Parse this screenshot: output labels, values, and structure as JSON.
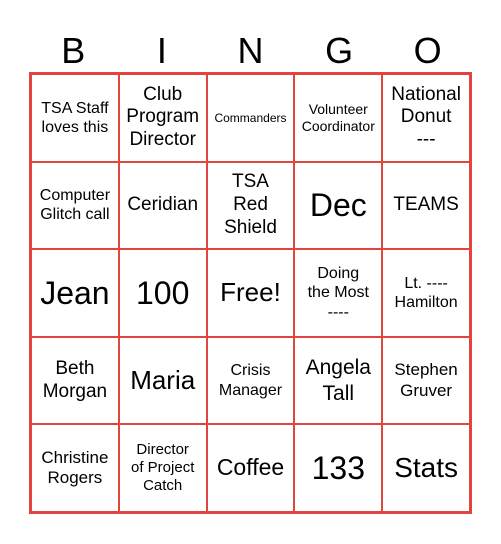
{
  "title_letters": [
    "B",
    "I",
    "N",
    "G",
    "O"
  ],
  "border_color": "#e0463e",
  "cells": [
    [
      "TSA Staff\nloves this",
      "Club\nProgram\nDirector",
      "Commanders",
      "Volunteer\nCoordinator",
      "National\nDonut\n---"
    ],
    [
      "Computer\nGlitch call",
      "Ceridian",
      "TSA\nRed\nShield",
      "Dec",
      "TEAMS"
    ],
    [
      "Jean",
      "100",
      "Free!",
      "Doing\nthe Most\n----",
      "Lt. ----\nHamilton"
    ],
    [
      "Beth\nMorgan",
      "Maria",
      "Crisis\nManager",
      "Angela\nTall",
      "Stephen\nGruver"
    ],
    [
      "Christine\nRogers",
      "Director\nof Project\nCatch",
      "Coffee",
      "133",
      "Stats"
    ]
  ]
}
